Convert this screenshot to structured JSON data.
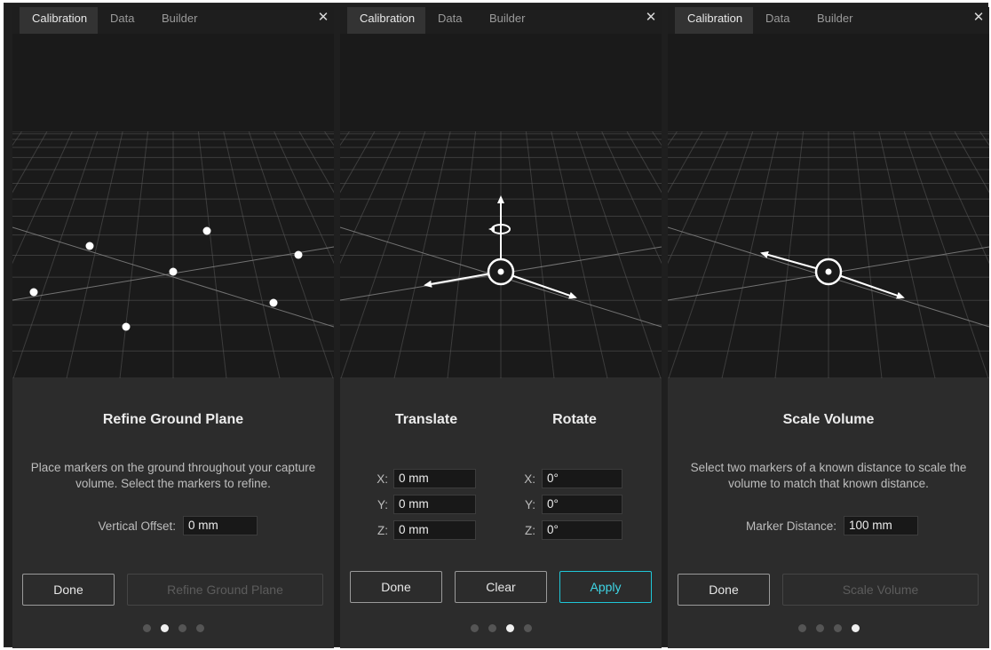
{
  "tabs": [
    "Calibration",
    "Data",
    "Builder"
  ],
  "close_label": "✕",
  "colors": {
    "accent": "#1fc7d8",
    "grid": "#5a5a5a",
    "background": "#1a1a1a"
  },
  "panels": [
    {
      "title": "Refine Ground Plane",
      "description": "Place markers on the ground throughout your capture volume. Select the markers to refine.",
      "field_label": "Vertical Offset:",
      "field_value": "0 mm",
      "done_label": "Done",
      "action_label": "Refine Ground Plane",
      "page_index": 1
    },
    {
      "translate_title": "Translate",
      "rotate_title": "Rotate",
      "translate": [
        {
          "label": "X:",
          "value": "0 mm"
        },
        {
          "label": "Y:",
          "value": "0 mm"
        },
        {
          "label": "Z:",
          "value": "0 mm"
        }
      ],
      "rotate": [
        {
          "label": "X:",
          "value": "0°"
        },
        {
          "label": "Y:",
          "value": "0°"
        },
        {
          "label": "Z:",
          "value": "0°"
        }
      ],
      "done_label": "Done",
      "clear_label": "Clear",
      "apply_label": "Apply",
      "page_index": 2
    },
    {
      "title": "Scale Volume",
      "description": "Select two markers of a known distance to scale the volume to match that known distance.",
      "field_label": "Marker Distance:",
      "field_value": "100 mm",
      "done_label": "Done",
      "action_label": "Scale Volume",
      "page_index": 3
    }
  ]
}
